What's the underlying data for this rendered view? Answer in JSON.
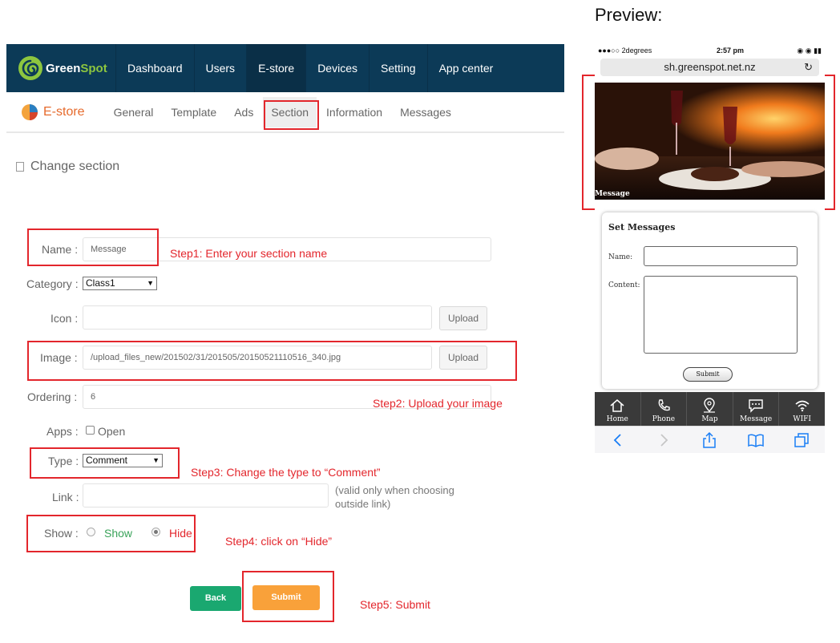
{
  "admin": {
    "logo_text_a": "Green",
    "logo_text_b": "Spot",
    "nav": [
      "Dashboard",
      "Users",
      "E-store",
      "Devices",
      "Setting",
      "App center"
    ],
    "sub_brand": "E-store",
    "sub_tabs": [
      "General",
      "Template",
      "Ads",
      "Section",
      "Information",
      "Messages"
    ],
    "heading": "Change section"
  },
  "form": {
    "name_label": "Name :",
    "name_value": "Message",
    "category_label": "Category :",
    "category_value": "Class1",
    "icon_label": "Icon :",
    "upload_label": "Upload",
    "image_label": "Image :",
    "image_value": "/upload_files_new/201502/31/201505/20150521110516_340.jpg",
    "ordering_label": "Ordering :",
    "ordering_value": "6",
    "apps_label": "Apps :",
    "apps_option": "Open",
    "type_label": "Type :",
    "type_value": "Comment",
    "link_label": "Link :",
    "link_note": "(valid only when choosing outside link)",
    "show_label": "Show :",
    "show_option": "Show",
    "hide_option": "Hide",
    "back_label": "Back",
    "submit_label": "Submit"
  },
  "steps": {
    "step1": "Step1: Enter your section name",
    "step2": "Step2: Upload your image",
    "step3": "Step3: Change the type to “Comment”",
    "step4": "Step4: click on “Hide”",
    "step5": "Step5: Submit"
  },
  "preview": {
    "title": "Preview:",
    "carrier": "●●●○○ 2degrees",
    "time": "2:57 pm",
    "url": "sh.greenspot.net.nz",
    "hero_caption": "Message",
    "card_title": "Set Messages",
    "name_label": "Name:",
    "content_label": "Content:",
    "submit": "Submit",
    "tabs": [
      "Home",
      "Phone",
      "Map",
      "Message",
      "WIFI"
    ]
  },
  "colors": {
    "nav_bg": "#0c3a57",
    "accent_green": "#8dc63f",
    "annotation_red": "#e3262c",
    "back_green": "#1aa870",
    "submit_orange": "#f9a13a",
    "show_green": "#3aa35a",
    "hide_red": "#e3262c"
  }
}
